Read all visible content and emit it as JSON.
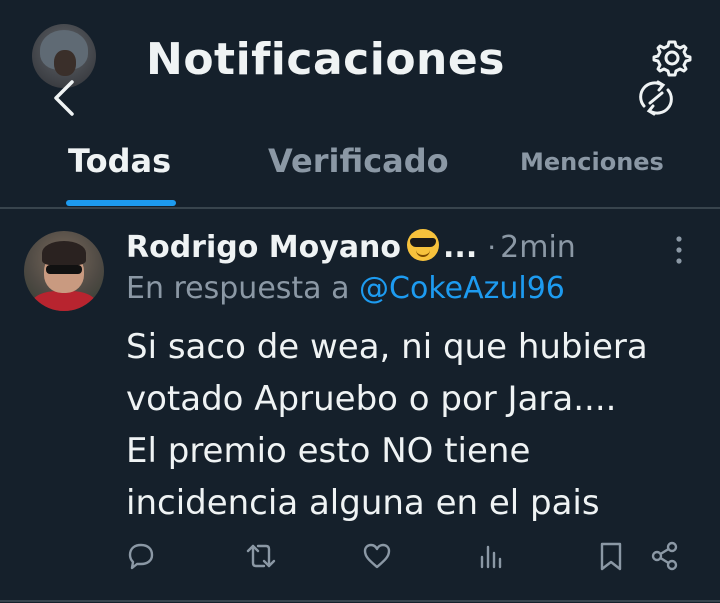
{
  "header": {
    "title": "Notificaciones"
  },
  "tabs": [
    {
      "label": "Todas",
      "active": true
    },
    {
      "label": "Verificado",
      "active": false
    },
    {
      "label": "Menciones",
      "active": false
    }
  ],
  "tweet": {
    "author_name": "Rodrigo Moyano",
    "name_truncation": "...",
    "separator": "·",
    "time": "2min",
    "reply_prefix": "En respuesta a",
    "reply_to": "@CokeAzul96",
    "text_lines": [
      "Si saco de wea, ni que hubiera",
      "votado Apruebo o por Jara....",
      "El premio esto NO tiene",
      "incidencia alguna en el pais"
    ]
  },
  "icons": {
    "back": "chevron-left-icon",
    "settings": "gear-icon",
    "account_switch": "swap-icon",
    "more": "more-vertical-icon",
    "reply": "reply-icon",
    "retweet": "retweet-icon",
    "like": "heart-icon",
    "views": "views-icon",
    "bookmark": "bookmark-icon",
    "share": "share-icon"
  },
  "colors": {
    "background": "#15202b",
    "accent": "#1d9bf0",
    "muted": "#8b98a5",
    "text": "#eff3f4",
    "divider": "#38444d"
  }
}
